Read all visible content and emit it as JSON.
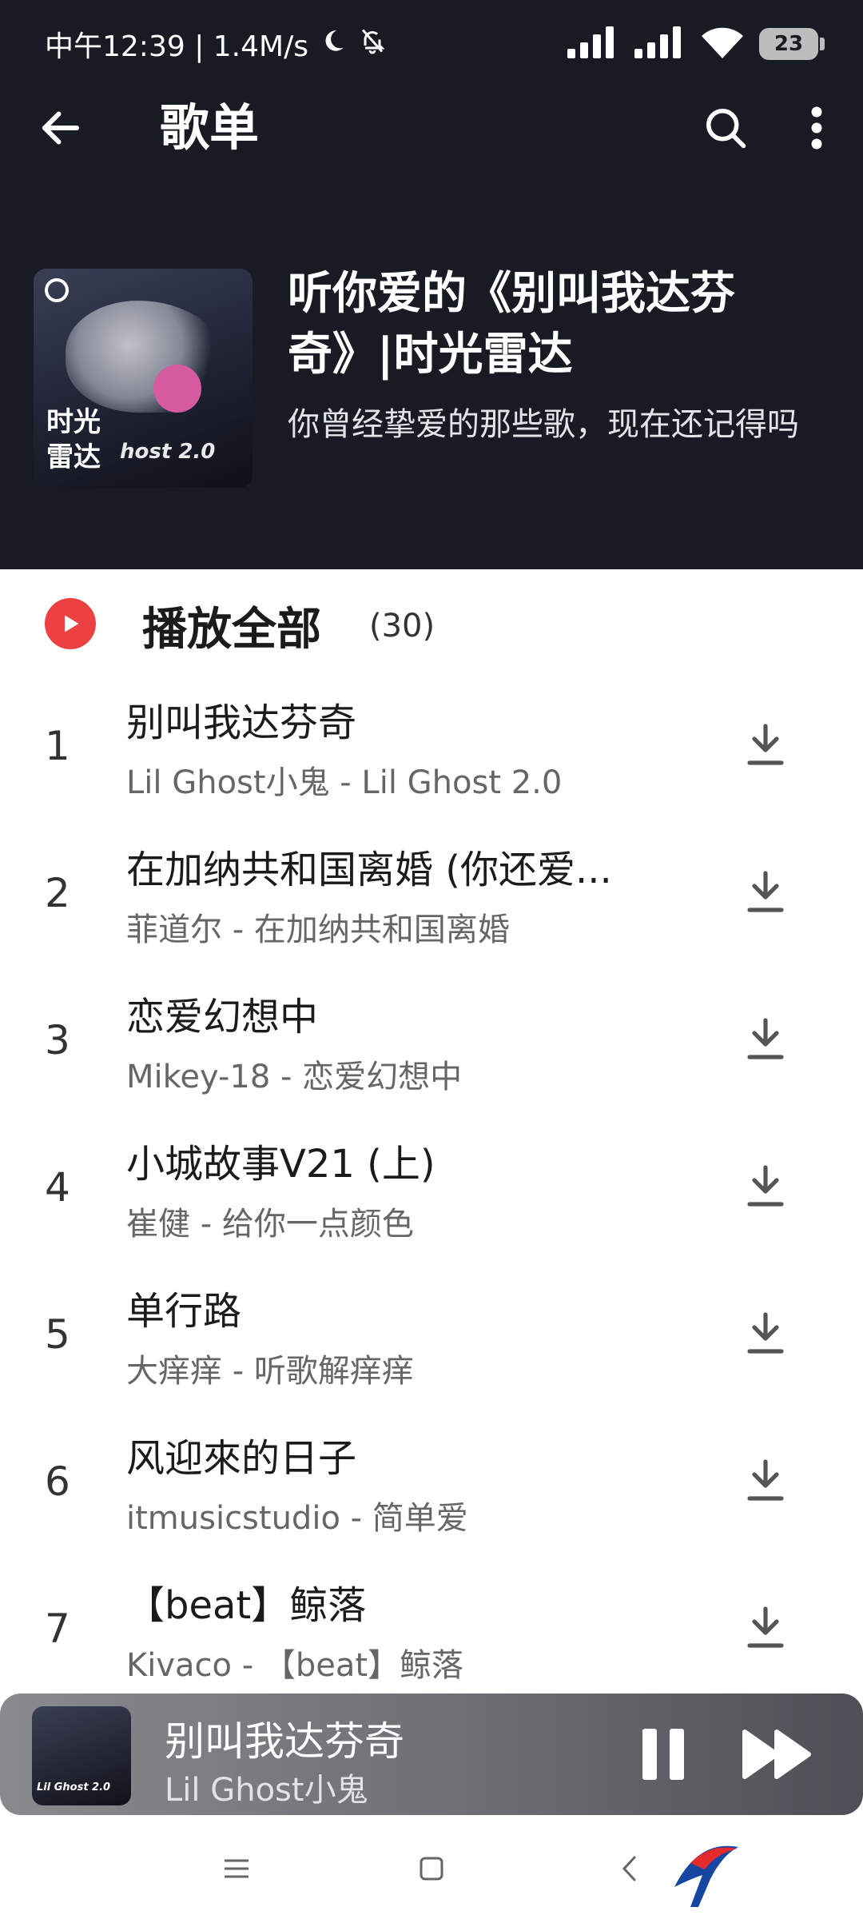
{
  "status_bar": {
    "time_speed": "中午12:39 | 1.4M/s",
    "battery": "23"
  },
  "topbar": {
    "title": "歌单"
  },
  "playlist": {
    "cover_label": "时光\n雷达",
    "cover_subtitle": "host 2.0",
    "title": "听你爱的《别叫我达芬奇》|时光雷达",
    "description": "你曾经挚爱的那些歌，现在还记得吗"
  },
  "play_all": {
    "label": "播放全部",
    "count": "(30)"
  },
  "songs": [
    {
      "num": "1",
      "title": "别叫我达芬奇",
      "subtitle": "Lil Ghost小鬼 - Lil Ghost 2.0"
    },
    {
      "num": "2",
      "title": "在加纳共和国离婚 (你还爱...",
      "subtitle": "菲道尔 - 在加纳共和国离婚"
    },
    {
      "num": "3",
      "title": "恋爱幻想中",
      "subtitle": "Mikey-18 - 恋爱幻想中"
    },
    {
      "num": "4",
      "title": "小城故事V21 (上)",
      "subtitle": "崔健 - 给你一点颜色"
    },
    {
      "num": "5",
      "title": "单行路",
      "subtitle": "大痒痒 - 听歌解痒痒"
    },
    {
      "num": "6",
      "title": "风迎來的日子",
      "subtitle": "itmusicstudio - 简单爱"
    },
    {
      "num": "7",
      "title": "【beat】鲸落",
      "subtitle": "Kivaco - 【beat】鲸落"
    }
  ],
  "mini_player": {
    "cover_text": "Lil Ghost 2.0",
    "title": "别叫我达芬奇",
    "artist": "Lil Ghost小鬼"
  },
  "colors": {
    "header_bg": "#191b24",
    "accent_red": "#ec4141"
  },
  "icons": [
    "back-arrow-icon",
    "search-icon",
    "more-vert-icon",
    "play-circle-icon",
    "download-icon",
    "pause-icon",
    "next-icon",
    "menu-icon",
    "home-square-icon",
    "back-chevron-icon"
  ]
}
